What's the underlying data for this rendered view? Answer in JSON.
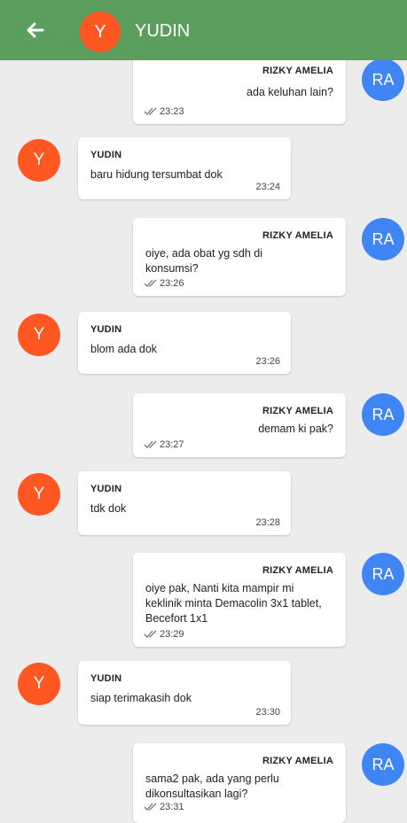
{
  "header": {
    "avatar_initial": "Y",
    "title": "YUDIN"
  },
  "messages": [
    {
      "direction": "out",
      "sender": "RIZKY AMELIA",
      "text": "ada keluhan lain?",
      "time": "23:23",
      "avatar": "RA"
    },
    {
      "direction": "in",
      "sender": "YUDIN",
      "text": "baru hidung tersumbat dok",
      "time": "23:24",
      "avatar": "Y"
    },
    {
      "direction": "out",
      "sender": "RIZKY AMELIA",
      "text": "oiye, ada obat yg sdh di konsumsi?",
      "time": "23:26",
      "avatar": "RA"
    },
    {
      "direction": "in",
      "sender": "YUDIN",
      "text": "blom ada dok",
      "time": "23:26",
      "avatar": "Y"
    },
    {
      "direction": "out",
      "sender": "RIZKY AMELIA",
      "text": "demam ki pak?",
      "time": "23:27",
      "avatar": "RA"
    },
    {
      "direction": "in",
      "sender": "YUDIN",
      "text": "tdk dok",
      "time": "23:28",
      "avatar": "Y"
    },
    {
      "direction": "out",
      "sender": "RIZKY AMELIA",
      "text": "oiye pak, Nanti kita mampir mi keklinik minta Demacolin 3x1 tablet, Becefort 1x1",
      "time": "23:29",
      "avatar": "RA"
    },
    {
      "direction": "in",
      "sender": "YUDIN",
      "text": "siap terimakasih dok",
      "time": "23:30",
      "avatar": "Y"
    },
    {
      "direction": "out",
      "sender": "RIZKY AMELIA",
      "text": "sama2 pak, ada yang perlu dikonsultasikan lagi?",
      "time": "23:31",
      "avatar": "RA"
    }
  ],
  "icons": {
    "back": "back-arrow-icon",
    "read": "double-check-icon"
  },
  "colors": {
    "header": "#5b9e5e",
    "incoming_avatar": "#ff5722",
    "outgoing_avatar": "#3f85f4",
    "background": "#ececec"
  }
}
